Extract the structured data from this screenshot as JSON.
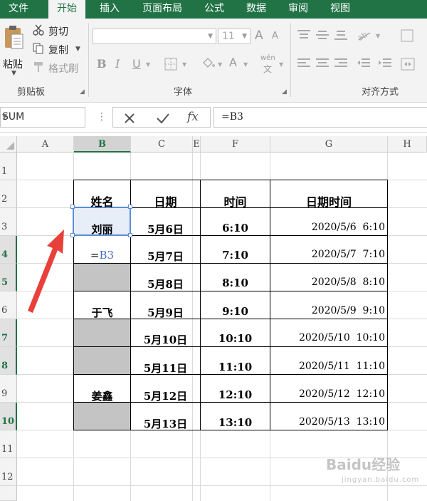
{
  "ribbon_tabs": [
    "文件",
    "开始",
    "插入",
    "页面布局",
    "公式",
    "数据",
    "审阅",
    "视图"
  ],
  "active_tab": "开始",
  "clipboard": {
    "paste": "粘贴",
    "cut": "剪切",
    "copy": "复制",
    "format_painter": "格式刷",
    "group_label": "剪贴板"
  },
  "font": {
    "font_name": "",
    "font_size": "11",
    "grow": "A",
    "shrink": "A",
    "bold": "B",
    "italic": "I",
    "underline": "U",
    "font_color": "A",
    "phonetic": "wén",
    "group_label": "字体"
  },
  "alignment": {
    "group_label": "对齐方式"
  },
  "formula_bar": {
    "name_box": "SUM",
    "formula": "=B3",
    "fx": "fx"
  },
  "columns": [
    "A",
    "B",
    "C",
    "E",
    "F",
    "G",
    "H"
  ],
  "selected_column": "B",
  "rows": [
    "1",
    "2",
    "3",
    "4",
    "5",
    "6",
    "7",
    "8",
    "9",
    "10",
    "11",
    "12"
  ],
  "selected_rows": [
    "4",
    "5",
    "7",
    "8",
    "10"
  ],
  "table": {
    "headers": [
      "姓名",
      "日期",
      "时间",
      "日期时间"
    ],
    "names": [
      "刘丽",
      "=B3",
      "",
      "于飞",
      "",
      "",
      "姜鑫",
      ""
    ],
    "dates": [
      "5月6日",
      "5月7日",
      "5月8日",
      "5月9日",
      "5月10日",
      "5月11日",
      "5月12日",
      "5月13日"
    ],
    "times": [
      "6:10",
      "7:10",
      "8:10",
      "9:10",
      "10:10",
      "11:10",
      "12:10",
      "13:10"
    ],
    "datetimes": [
      "2020/5/6  6:10",
      "2020/5/7  7:10",
      "2020/5/8  8:10",
      "2020/5/9  9:10",
      "2020/5/10  10:10",
      "2020/5/11  11:10",
      "2020/5/12  12:10",
      "2020/5/13  13:10"
    ]
  },
  "edit_cell_prefix": "=",
  "edit_cell_ref": "B3",
  "watermark": {
    "text": "Baidu经验",
    "sub": "jingyan.baidu.com"
  },
  "colors": {
    "excel_green": "#217346",
    "ref_blue": "#4472c4",
    "arrow_red": "#e8403a",
    "gray_fill": "#c4c4c4"
  }
}
